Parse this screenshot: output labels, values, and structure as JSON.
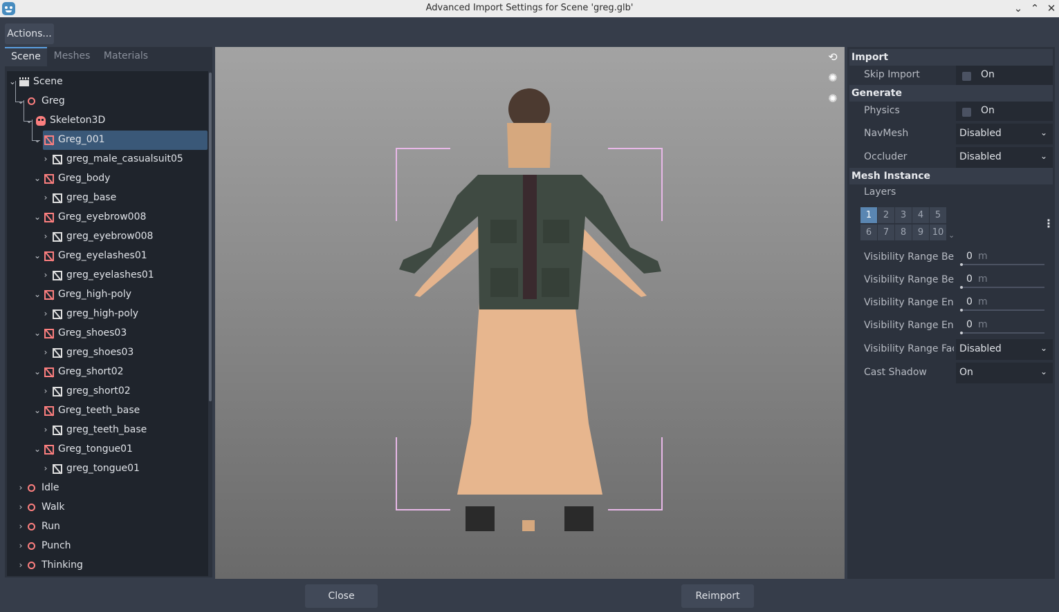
{
  "window": {
    "title": "Advanced Import Settings for Scene 'greg.glb'",
    "minimize_glyph": "⌄",
    "maximize_glyph": "⌃",
    "close_glyph": "✕"
  },
  "toolbar": {
    "actions_label": "Actions..."
  },
  "left_tabs": [
    "Scene",
    "Meshes",
    "Materials"
  ],
  "tree": [
    {
      "label": "Scene"
    },
    {
      "label": "Greg"
    },
    {
      "label": "Skeleton3D"
    },
    {
      "label": "Greg_001"
    },
    {
      "label": "greg_male_casualsuit05"
    },
    {
      "label": "Greg_body"
    },
    {
      "label": "greg_base"
    },
    {
      "label": "Greg_eyebrow008"
    },
    {
      "label": "greg_eyebrow008"
    },
    {
      "label": "Greg_eyelashes01"
    },
    {
      "label": "greg_eyelashes01"
    },
    {
      "label": "Greg_high-poly"
    },
    {
      "label": "greg_high-poly"
    },
    {
      "label": "Greg_shoes03"
    },
    {
      "label": "greg_shoes03"
    },
    {
      "label": "Greg_short02"
    },
    {
      "label": "greg_short02"
    },
    {
      "label": "Greg_teeth_base"
    },
    {
      "label": "greg_teeth_base"
    },
    {
      "label": "Greg_tongue01"
    },
    {
      "label": "greg_tongue01"
    },
    {
      "label": "Idle"
    },
    {
      "label": "Walk"
    },
    {
      "label": "Run"
    },
    {
      "label": "Punch"
    },
    {
      "label": "Thinking"
    }
  ],
  "inspector": {
    "import_section": "Import",
    "skip_import_label": "Skip Import",
    "skip_import_value": "On",
    "generate_section": "Generate",
    "physics_label": "Physics",
    "physics_value": "On",
    "navmesh_label": "NavMesh",
    "navmesh_value": "Disabled",
    "occluder_label": "Occluder",
    "occluder_value": "Disabled",
    "mesh_instance_section": "Mesh Instance",
    "layers_label": "Layers",
    "layers": [
      "1",
      "2",
      "3",
      "4",
      "5",
      "6",
      "7",
      "8",
      "9",
      "10"
    ],
    "vis_begin_label": "Visibility Range Be",
    "vis_begin_value": "0",
    "vis_begin_margin_label": "Visibility Range Be",
    "vis_begin_margin_value": "0",
    "vis_end_label": "Visibility Range End",
    "vis_end_value": "0",
    "vis_end_margin_label": "Visibility Range End",
    "vis_end_margin_value": "0",
    "unit": "m",
    "vis_fade_label": "Visibility Range Fad",
    "vis_fade_value": "Disabled",
    "cast_shadow_label": "Cast Shadow",
    "cast_shadow_value": "On"
  },
  "buttons": {
    "close": "Close",
    "reimport": "Reimport"
  },
  "colors": {
    "accent": "#5a9ee0",
    "node_red": "#fc7f7f",
    "selected_row": "#3a5878"
  }
}
